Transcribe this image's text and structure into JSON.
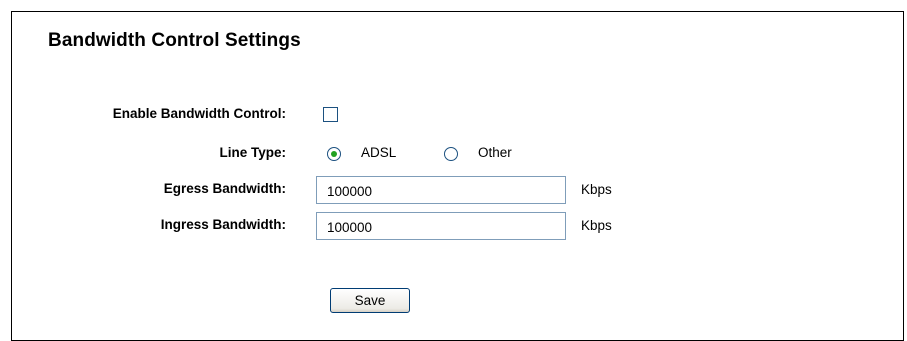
{
  "page": {
    "title": "Bandwidth Control Settings"
  },
  "form": {
    "enable": {
      "label": "Enable Bandwidth Control:",
      "checked": false
    },
    "line_type": {
      "label": "Line Type:",
      "options": [
        {
          "label": "ADSL",
          "selected": true
        },
        {
          "label": "Other",
          "selected": false
        }
      ]
    },
    "egress": {
      "label": "Egress Bandwidth:",
      "value": "100000",
      "unit": "Kbps"
    },
    "ingress": {
      "label": "Ingress Bandwidth:",
      "value": "100000",
      "unit": "Kbps"
    },
    "save_label": "Save"
  },
  "colors": {
    "control_border": "#1c5180",
    "radio_selected": "#21a121",
    "input_border": "#7f9db9",
    "button_border": "#003c74"
  },
  "icons": {
    "checkbox": "checkbox-unchecked-icon",
    "radio_on": "radio-selected-icon",
    "radio_off": "radio-unselected-icon"
  }
}
